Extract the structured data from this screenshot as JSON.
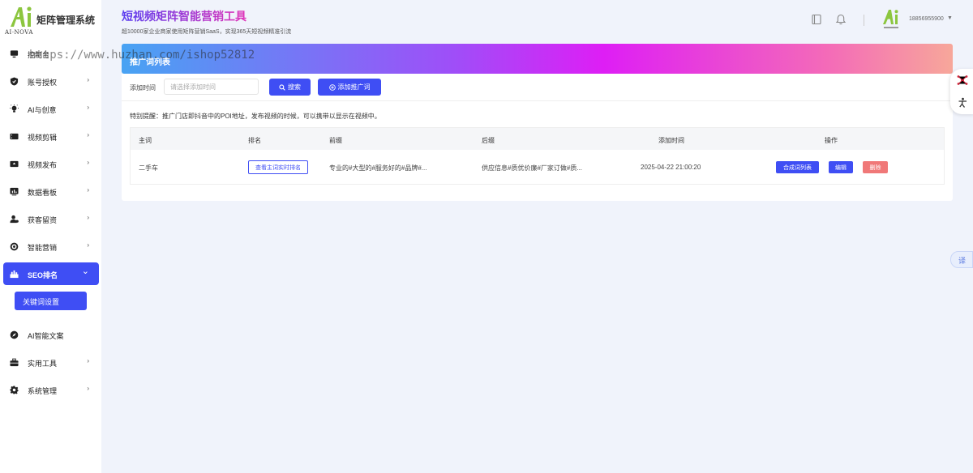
{
  "sidebar": {
    "logo_mark": "Ai",
    "logo_sub": "AI·NOVA",
    "app_name": "矩阵管理系统",
    "menu": [
      {
        "label": "控制台",
        "icon": "monitor-icon",
        "has_arrow": false
      },
      {
        "label": "账号授权",
        "icon": "shield-icon",
        "has_arrow": true,
        "arrow": "›"
      },
      {
        "label": "AI与创意",
        "icon": "lightbulb-icon",
        "has_arrow": true,
        "arrow": "›"
      },
      {
        "label": "视频剪辑",
        "icon": "film-icon",
        "has_arrow": true,
        "arrow": "›"
      },
      {
        "label": "视频发布",
        "icon": "upload-video-icon",
        "has_arrow": true,
        "arrow": "›"
      },
      {
        "label": "数据看板",
        "icon": "chart-board-icon",
        "has_arrow": true,
        "arrow": "›"
      },
      {
        "label": "获客留资",
        "icon": "users-icon",
        "has_arrow": true,
        "arrow": "›"
      },
      {
        "label": "智能营销",
        "icon": "target-icon",
        "has_arrow": true,
        "arrow": "›"
      },
      {
        "label": "SEO排名",
        "icon": "ranking-icon",
        "has_arrow": true,
        "arrow": "⌄",
        "active": true
      },
      {
        "label": "AI智能文案",
        "icon": "compass-icon",
        "has_arrow": false
      },
      {
        "label": "实用工具",
        "icon": "toolbox-icon",
        "has_arrow": true,
        "arrow": "›"
      },
      {
        "label": "系统管理",
        "icon": "gear-icon",
        "has_arrow": true,
        "arrow": "›"
      }
    ],
    "submenu_active": "关键词设置"
  },
  "header": {
    "title": "短视频矩阵智能营销工具",
    "subtitle": "超10000家企业商家使用矩阵营销SaaS，实现365天短视频精准引流",
    "user_phone": "18856955900",
    "caret": "▼"
  },
  "watermark": "https://www.huzhan.com/ishop52812",
  "banner": {
    "title": "推广词列表"
  },
  "filter": {
    "label": "添加时间",
    "placeholder": "请选择添加时间",
    "search_label": "搜索",
    "add_label": "添加推广词"
  },
  "notice": "特别提醒：推广门店即抖音中的POI地址，发布视频的时候，可以携带以显示在视频中。",
  "table": {
    "headers": [
      "主词",
      "排名",
      "前缀",
      "后缀",
      "添加时间",
      "操作"
    ],
    "rows": [
      {
        "main_word": "二手车",
        "rank_button": "查看主词实时排名",
        "prefix": "专业的#大型的#服务好的#品牌#...",
        "suffix": "供应信息#质优价廉#厂家订做#质...",
        "added_time": "2025-04-22 21:00:20",
        "actions": {
          "compose": "合成词列表",
          "edit": "编辑",
          "delete": "删除"
        }
      }
    ]
  },
  "floating": {
    "translate_label": "译"
  },
  "colors": {
    "primary": "#3f4ef4",
    "delete": "#f07878",
    "background": "#f0f3fb"
  }
}
